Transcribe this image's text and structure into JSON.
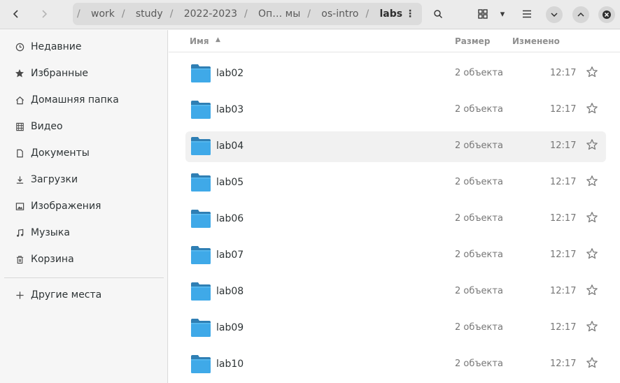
{
  "header": {
    "back_icon": "chevron-left-icon",
    "forward_icon": "chevron-right-icon",
    "path": [
      "work",
      "study",
      "2022-2023",
      "Оп… мы",
      "os-intro",
      "labs"
    ],
    "path_root_sep": "/",
    "path_sep": "/",
    "path_menu_icon": "⋮",
    "search_icon": "search-icon",
    "view_icon": "grid-view-icon",
    "view_dropdown_icon": "▾",
    "menu_icon": "hamburger-menu-icon",
    "minimize_icon": "chevron-down-icon",
    "maximize_icon": "chevron-up-icon",
    "close_icon": "close-icon"
  },
  "sidebar": {
    "items": [
      {
        "label": "Недавние",
        "icon": "clock-icon"
      },
      {
        "label": "Избранные",
        "icon": "star-icon"
      },
      {
        "label": "Домашняя папка",
        "icon": "home-icon"
      },
      {
        "label": "Видео",
        "icon": "video-icon"
      },
      {
        "label": "Документы",
        "icon": "document-icon"
      },
      {
        "label": "Загрузки",
        "icon": "download-icon"
      },
      {
        "label": "Изображения",
        "icon": "image-icon"
      },
      {
        "label": "Музыка",
        "icon": "music-icon"
      },
      {
        "label": "Корзина",
        "icon": "trash-icon"
      }
    ],
    "other_places": {
      "label": "Другие места",
      "icon": "plus-icon"
    }
  },
  "columns": {
    "name": "Имя",
    "size": "Размер",
    "modified": "Изменено"
  },
  "files": [
    {
      "name": "lab02",
      "size": "2 объекта",
      "modified": "12:17"
    },
    {
      "name": "lab03",
      "size": "2 объекта",
      "modified": "12:17"
    },
    {
      "name": "lab04",
      "size": "2 объекта",
      "modified": "12:17"
    },
    {
      "name": "lab05",
      "size": "2 объекта",
      "modified": "12:17"
    },
    {
      "name": "lab06",
      "size": "2 объекта",
      "modified": "12:17"
    },
    {
      "name": "lab07",
      "size": "2 объекта",
      "modified": "12:17"
    },
    {
      "name": "lab08",
      "size": "2 объекта",
      "modified": "12:17"
    },
    {
      "name": "lab09",
      "size": "2 объекта",
      "modified": "12:17"
    },
    {
      "name": "lab10",
      "size": "2 объекта",
      "modified": "12:17"
    }
  ],
  "colors": {
    "folder": "#3fa9e8",
    "folder_tab": "#2f7fb4",
    "accent": "#3584e4"
  }
}
